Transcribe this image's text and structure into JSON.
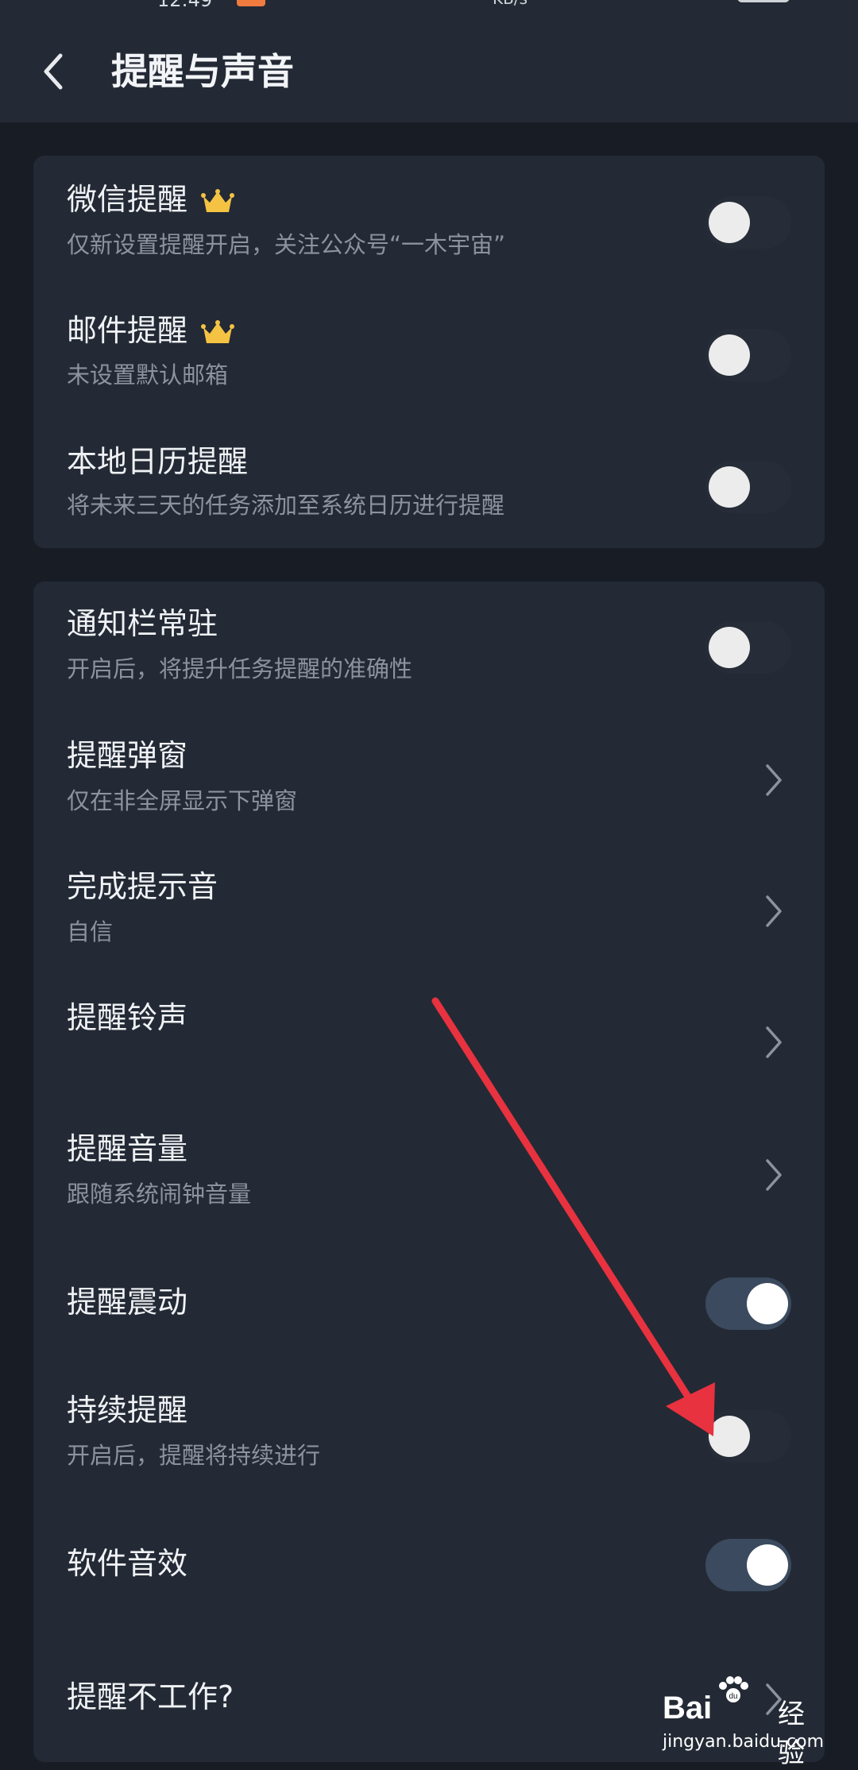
{
  "status_bar": {
    "time": "12:49",
    "net_speed": "KB/s"
  },
  "header": {
    "title": "提醒与声音"
  },
  "group1": [
    {
      "title": "微信提醒",
      "subtitle": "仅新设置提醒开启，关注公众号“一木宇宙”",
      "premium": true,
      "control": "toggle",
      "on": false
    },
    {
      "title": "邮件提醒",
      "subtitle": "未设置默认邮箱",
      "premium": true,
      "control": "toggle",
      "on": false
    },
    {
      "title": "本地日历提醒",
      "subtitle": "将未来三天的任务添加至系统日历进行提醒",
      "premium": false,
      "control": "toggle",
      "on": false
    }
  ],
  "group2": [
    {
      "title": "通知栏常驻",
      "subtitle": "开启后，将提升任务提醒的准确性",
      "control": "toggle",
      "on": false
    },
    {
      "title": "提醒弹窗",
      "subtitle": "仅在非全屏显示下弹窗",
      "control": "chevron"
    },
    {
      "title": "完成提示音",
      "subtitle": "自信",
      "control": "chevron"
    },
    {
      "title": "提醒铃声",
      "subtitle": "",
      "control": "chevron"
    },
    {
      "title": "提醒音量",
      "subtitle": "跟随系统闹钟音量",
      "control": "chevron"
    },
    {
      "title": "提醒震动",
      "subtitle": "",
      "control": "toggle",
      "on": true
    },
    {
      "title": "持续提醒",
      "subtitle": "开启后，提醒将持续进行",
      "control": "toggle",
      "on": false
    },
    {
      "title": "软件音效",
      "subtitle": "",
      "control": "toggle",
      "on": true
    },
    {
      "title": "提醒不工作?",
      "subtitle": "",
      "control": "chevron"
    }
  ],
  "annotation": {
    "color": "#e8323f"
  },
  "watermark": {
    "brand_left": "Bai",
    "brand_right": "经验",
    "brand_du": "du",
    "url": "jingyan.baidu.com"
  },
  "colors": {
    "background": "#181d25",
    "card": "#232a35",
    "toggle_on": "#3b4a5e",
    "crown": "#f5c343"
  }
}
